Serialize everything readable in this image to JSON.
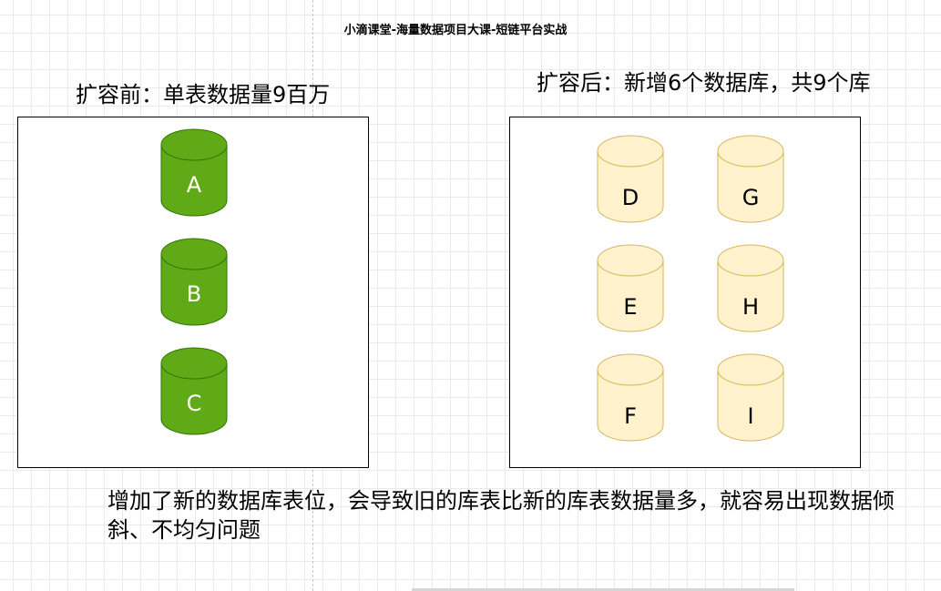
{
  "title": "小滴课堂-海量数据项目大课-短链平台实战",
  "before": {
    "heading": "扩容前：单表数据量9百万",
    "databases": [
      "A",
      "B",
      "C"
    ]
  },
  "after": {
    "heading": "扩容后：新增6个数据库，共9个库",
    "databases": [
      "D",
      "G",
      "E",
      "H",
      "F",
      "I"
    ]
  },
  "note": "增加了新的数据库表位，会导致旧的库表比新的库表数据量多，就容易出现数据倾斜、不均匀问题",
  "colors": {
    "green_fill": "#60a917",
    "green_stroke": "#2d7600",
    "yellow_fill": "#fff2cc",
    "yellow_stroke": "#d6b656"
  }
}
